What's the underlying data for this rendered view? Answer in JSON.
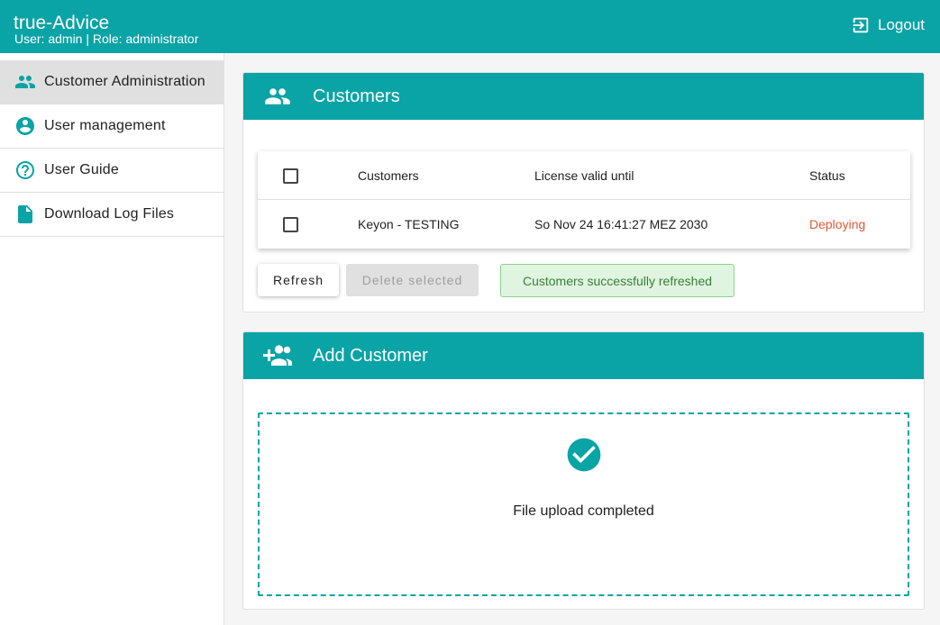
{
  "app": {
    "title": "true-Advice",
    "user_info": "User: admin | Role: administrator",
    "logout_label": "Logout"
  },
  "sidebar": {
    "items": [
      {
        "label": "Customer Administration",
        "icon": "people-icon",
        "active": true
      },
      {
        "label": "User management",
        "icon": "account-circle-icon",
        "active": false
      },
      {
        "label": "User Guide",
        "icon": "help-circle-icon",
        "active": false
      },
      {
        "label": "Download Log Files",
        "icon": "file-icon",
        "active": false
      }
    ]
  },
  "customers_card": {
    "title": "Customers",
    "icon": "people-icon",
    "table": {
      "headers": [
        "Customers",
        "License valid until",
        "Status"
      ],
      "rows": [
        {
          "customer": "Keyon - TESTING",
          "license_valid_until": "So Nov 24 16:41:27 MEZ 2030",
          "status": "Deploying"
        }
      ]
    },
    "refresh_label": "Refresh",
    "delete_label": "Delete selected",
    "alert_text": "Customers successfully refreshed"
  },
  "add_customer_card": {
    "title": "Add Customer",
    "icon": "add-people-icon",
    "upload_status": "File upload completed"
  },
  "colors": {
    "primary": "#0aa3a6",
    "status_deploying": "#e05a3a",
    "alert_bg": "#dff5df",
    "alert_text": "#3c7d3c"
  }
}
